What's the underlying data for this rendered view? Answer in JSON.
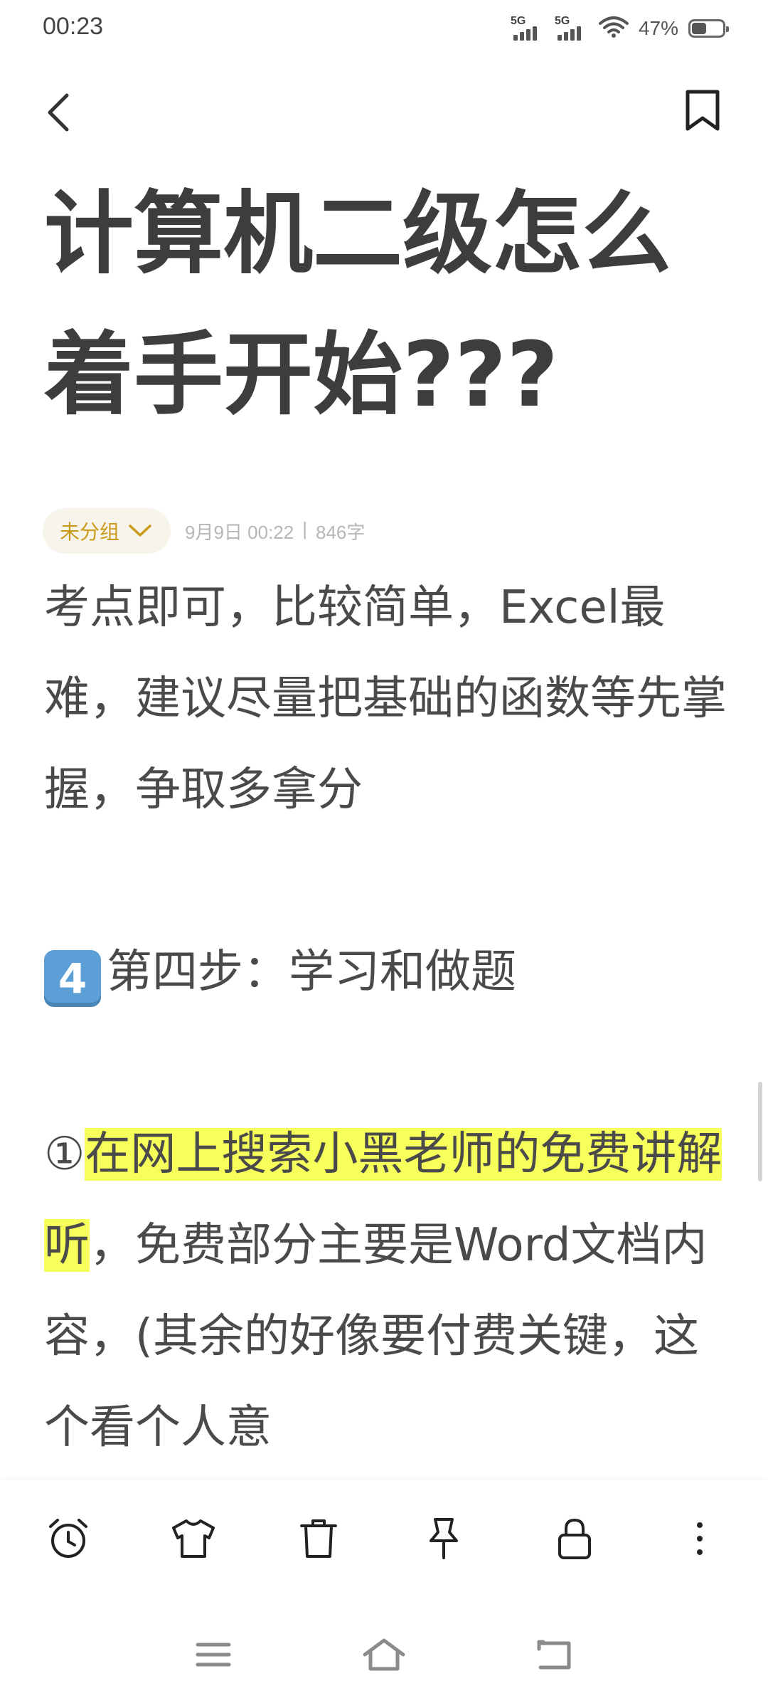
{
  "status_bar": {
    "time": "00:23",
    "signal1_label": "5G",
    "signal2_label": "5G",
    "battery_percent": "47%",
    "battery_level": 0.47
  },
  "header": {
    "back_icon": "chevron-left-icon",
    "bookmark_icon": "bookmark-icon"
  },
  "note": {
    "title": "计算机二级怎么着手开始???",
    "group": "未分组",
    "date": "9月9日 00:22",
    "separator": "|",
    "word_count": "846字",
    "paragraphs": {
      "p1": "考点即可，比较简单，Excel最难，建议尽量把基础的函数等先掌握，争取多拿分",
      "step4_keycap": "4",
      "step4": "第四步：学习和做题",
      "item1_num": "①",
      "item1_highlight": "在网上搜索小黑老师的免费讲解听",
      "item1_rest": "，免费部分主要是Word文档内容，(其余的好像要付费关键，这个看个人意"
    }
  },
  "toolbar": {
    "icons": [
      "alarm-icon",
      "shirt-icon",
      "trash-icon",
      "pin-icon",
      "lock-icon",
      "more-icon"
    ]
  },
  "navbar": {
    "icons": [
      "menu-icon",
      "home-icon",
      "back-icon"
    ]
  },
  "colors": {
    "accent": "#c99b19",
    "highlight": "#f7ff5a",
    "text": "#4a4a4a"
  }
}
